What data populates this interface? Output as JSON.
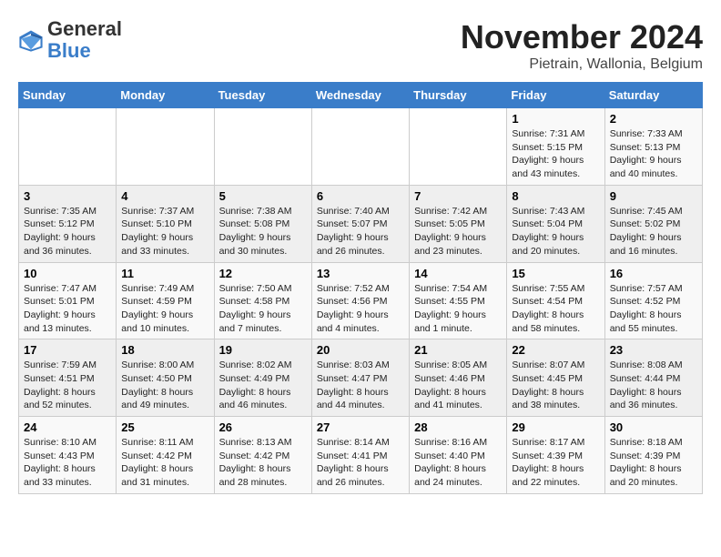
{
  "header": {
    "logo_general": "General",
    "logo_blue": "Blue",
    "month_title": "November 2024",
    "location": "Pietrain, Wallonia, Belgium"
  },
  "weekdays": [
    "Sunday",
    "Monday",
    "Tuesday",
    "Wednesday",
    "Thursday",
    "Friday",
    "Saturday"
  ],
  "weeks": [
    [
      {
        "day": "",
        "sunrise": "",
        "sunset": "",
        "daylight": ""
      },
      {
        "day": "",
        "sunrise": "",
        "sunset": "",
        "daylight": ""
      },
      {
        "day": "",
        "sunrise": "",
        "sunset": "",
        "daylight": ""
      },
      {
        "day": "",
        "sunrise": "",
        "sunset": "",
        "daylight": ""
      },
      {
        "day": "",
        "sunrise": "",
        "sunset": "",
        "daylight": ""
      },
      {
        "day": "1",
        "sunrise": "Sunrise: 7:31 AM",
        "sunset": "Sunset: 5:15 PM",
        "daylight": "Daylight: 9 hours and 43 minutes."
      },
      {
        "day": "2",
        "sunrise": "Sunrise: 7:33 AM",
        "sunset": "Sunset: 5:13 PM",
        "daylight": "Daylight: 9 hours and 40 minutes."
      }
    ],
    [
      {
        "day": "3",
        "sunrise": "Sunrise: 7:35 AM",
        "sunset": "Sunset: 5:12 PM",
        "daylight": "Daylight: 9 hours and 36 minutes."
      },
      {
        "day": "4",
        "sunrise": "Sunrise: 7:37 AM",
        "sunset": "Sunset: 5:10 PM",
        "daylight": "Daylight: 9 hours and 33 minutes."
      },
      {
        "day": "5",
        "sunrise": "Sunrise: 7:38 AM",
        "sunset": "Sunset: 5:08 PM",
        "daylight": "Daylight: 9 hours and 30 minutes."
      },
      {
        "day": "6",
        "sunrise": "Sunrise: 7:40 AM",
        "sunset": "Sunset: 5:07 PM",
        "daylight": "Daylight: 9 hours and 26 minutes."
      },
      {
        "day": "7",
        "sunrise": "Sunrise: 7:42 AM",
        "sunset": "Sunset: 5:05 PM",
        "daylight": "Daylight: 9 hours and 23 minutes."
      },
      {
        "day": "8",
        "sunrise": "Sunrise: 7:43 AM",
        "sunset": "Sunset: 5:04 PM",
        "daylight": "Daylight: 9 hours and 20 minutes."
      },
      {
        "day": "9",
        "sunrise": "Sunrise: 7:45 AM",
        "sunset": "Sunset: 5:02 PM",
        "daylight": "Daylight: 9 hours and 16 minutes."
      }
    ],
    [
      {
        "day": "10",
        "sunrise": "Sunrise: 7:47 AM",
        "sunset": "Sunset: 5:01 PM",
        "daylight": "Daylight: 9 hours and 13 minutes."
      },
      {
        "day": "11",
        "sunrise": "Sunrise: 7:49 AM",
        "sunset": "Sunset: 4:59 PM",
        "daylight": "Daylight: 9 hours and 10 minutes."
      },
      {
        "day": "12",
        "sunrise": "Sunrise: 7:50 AM",
        "sunset": "Sunset: 4:58 PM",
        "daylight": "Daylight: 9 hours and 7 minutes."
      },
      {
        "day": "13",
        "sunrise": "Sunrise: 7:52 AM",
        "sunset": "Sunset: 4:56 PM",
        "daylight": "Daylight: 9 hours and 4 minutes."
      },
      {
        "day": "14",
        "sunrise": "Sunrise: 7:54 AM",
        "sunset": "Sunset: 4:55 PM",
        "daylight": "Daylight: 9 hours and 1 minute."
      },
      {
        "day": "15",
        "sunrise": "Sunrise: 7:55 AM",
        "sunset": "Sunset: 4:54 PM",
        "daylight": "Daylight: 8 hours and 58 minutes."
      },
      {
        "day": "16",
        "sunrise": "Sunrise: 7:57 AM",
        "sunset": "Sunset: 4:52 PM",
        "daylight": "Daylight: 8 hours and 55 minutes."
      }
    ],
    [
      {
        "day": "17",
        "sunrise": "Sunrise: 7:59 AM",
        "sunset": "Sunset: 4:51 PM",
        "daylight": "Daylight: 8 hours and 52 minutes."
      },
      {
        "day": "18",
        "sunrise": "Sunrise: 8:00 AM",
        "sunset": "Sunset: 4:50 PM",
        "daylight": "Daylight: 8 hours and 49 minutes."
      },
      {
        "day": "19",
        "sunrise": "Sunrise: 8:02 AM",
        "sunset": "Sunset: 4:49 PM",
        "daylight": "Daylight: 8 hours and 46 minutes."
      },
      {
        "day": "20",
        "sunrise": "Sunrise: 8:03 AM",
        "sunset": "Sunset: 4:47 PM",
        "daylight": "Daylight: 8 hours and 44 minutes."
      },
      {
        "day": "21",
        "sunrise": "Sunrise: 8:05 AM",
        "sunset": "Sunset: 4:46 PM",
        "daylight": "Daylight: 8 hours and 41 minutes."
      },
      {
        "day": "22",
        "sunrise": "Sunrise: 8:07 AM",
        "sunset": "Sunset: 4:45 PM",
        "daylight": "Daylight: 8 hours and 38 minutes."
      },
      {
        "day": "23",
        "sunrise": "Sunrise: 8:08 AM",
        "sunset": "Sunset: 4:44 PM",
        "daylight": "Daylight: 8 hours and 36 minutes."
      }
    ],
    [
      {
        "day": "24",
        "sunrise": "Sunrise: 8:10 AM",
        "sunset": "Sunset: 4:43 PM",
        "daylight": "Daylight: 8 hours and 33 minutes."
      },
      {
        "day": "25",
        "sunrise": "Sunrise: 8:11 AM",
        "sunset": "Sunset: 4:42 PM",
        "daylight": "Daylight: 8 hours and 31 minutes."
      },
      {
        "day": "26",
        "sunrise": "Sunrise: 8:13 AM",
        "sunset": "Sunset: 4:42 PM",
        "daylight": "Daylight: 8 hours and 28 minutes."
      },
      {
        "day": "27",
        "sunrise": "Sunrise: 8:14 AM",
        "sunset": "Sunset: 4:41 PM",
        "daylight": "Daylight: 8 hours and 26 minutes."
      },
      {
        "day": "28",
        "sunrise": "Sunrise: 8:16 AM",
        "sunset": "Sunset: 4:40 PM",
        "daylight": "Daylight: 8 hours and 24 minutes."
      },
      {
        "day": "29",
        "sunrise": "Sunrise: 8:17 AM",
        "sunset": "Sunset: 4:39 PM",
        "daylight": "Daylight: 8 hours and 22 minutes."
      },
      {
        "day": "30",
        "sunrise": "Sunrise: 8:18 AM",
        "sunset": "Sunset: 4:39 PM",
        "daylight": "Daylight: 8 hours and 20 minutes."
      }
    ]
  ]
}
